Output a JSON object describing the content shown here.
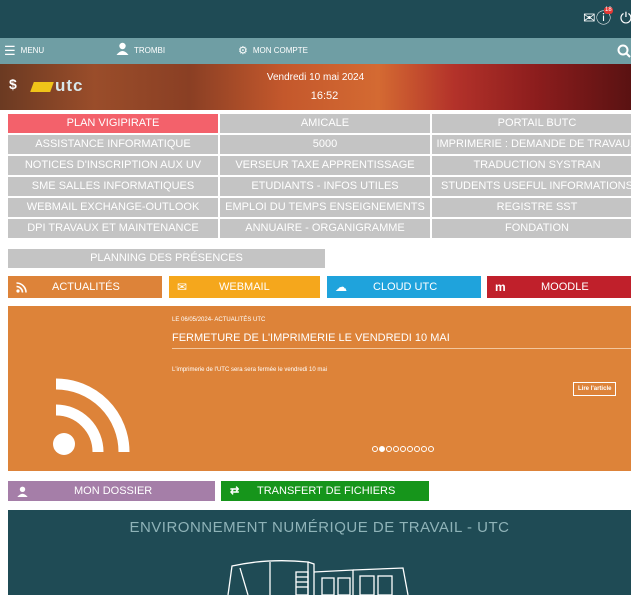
{
  "topbar": {
    "mail_icon": "mail-icon",
    "info_icon": "info-icon",
    "notif_count": "18",
    "power_icon": "power-icon"
  },
  "nav": {
    "menu": "MENU",
    "trombi": "TROMBI",
    "account": "MON COMPTE",
    "search_icon": "search-icon"
  },
  "banner": {
    "logo": "utc",
    "date": "Vendredi 10 mai 2024",
    "time": "16:52"
  },
  "links": [
    [
      "PLAN VIGIPIRATE",
      "AMICALE",
      "PORTAIL BUTC"
    ],
    [
      "ASSISTANCE INFORMATIQUE",
      "5000",
      "IMPRIMERIE : DEMANDE DE TRAVAUX"
    ],
    [
      "NOTICES D'INSCRIPTION AUX UV",
      "VERSEUR TAXE APPRENTISSAGE",
      "TRADUCTION SYSTRAN"
    ],
    [
      "SME SALLES INFORMATIQUES",
      "ETUDIANTS - INFOS UTILES",
      "STUDENTS USEFUL INFORMATIONS"
    ],
    [
      "WEBMAIL EXCHANGE-OUTLOOK",
      "EMPLOI DU TEMPS ENSEIGNEMENTS",
      "REGISTRE SST"
    ],
    [
      "DPI TRAVAUX ET MAINTENANCE",
      "ANNUAIRE - ORGANIGRAMME",
      "FONDATION"
    ],
    [
      "PLANNING DES PRÉSENCES"
    ]
  ],
  "tiles": {
    "actualites": "ACTUALITÉS",
    "webmail": "WEBMAIL",
    "cloud": "CLOUD UTC",
    "moodle": "MOODLE"
  },
  "news": {
    "meta": "LE 06/05/2024- ACTUALITÉS UTC",
    "title": "FERMETURE DE L'IMPRIMERIE LE VENDREDI 10 MAI",
    "body": "L'imprimerie de l'UTC sera sera fermée le vendredi 10 mai",
    "more": "Lire l'article",
    "slides": 9,
    "active_slide": 2
  },
  "quick": {
    "dossier": "MON DOSSIER",
    "transfert": "TRANSFERT DE FICHIERS"
  },
  "footer": {
    "title": "ENVIRONNEMENT NUMÉRIQUE DE TRAVAIL - UTC"
  },
  "colors": {
    "dark": "#1f4b55",
    "nav": "#6f9ea4",
    "vigipirate": "#f3616b",
    "grey": "#c4c4c4",
    "actualites": "#dd8339",
    "webmail": "#f5a71c",
    "cloud": "#1fa3dc",
    "moodle": "#c0202b",
    "dossier": "#a57ea8",
    "transfert": "#16951b"
  }
}
